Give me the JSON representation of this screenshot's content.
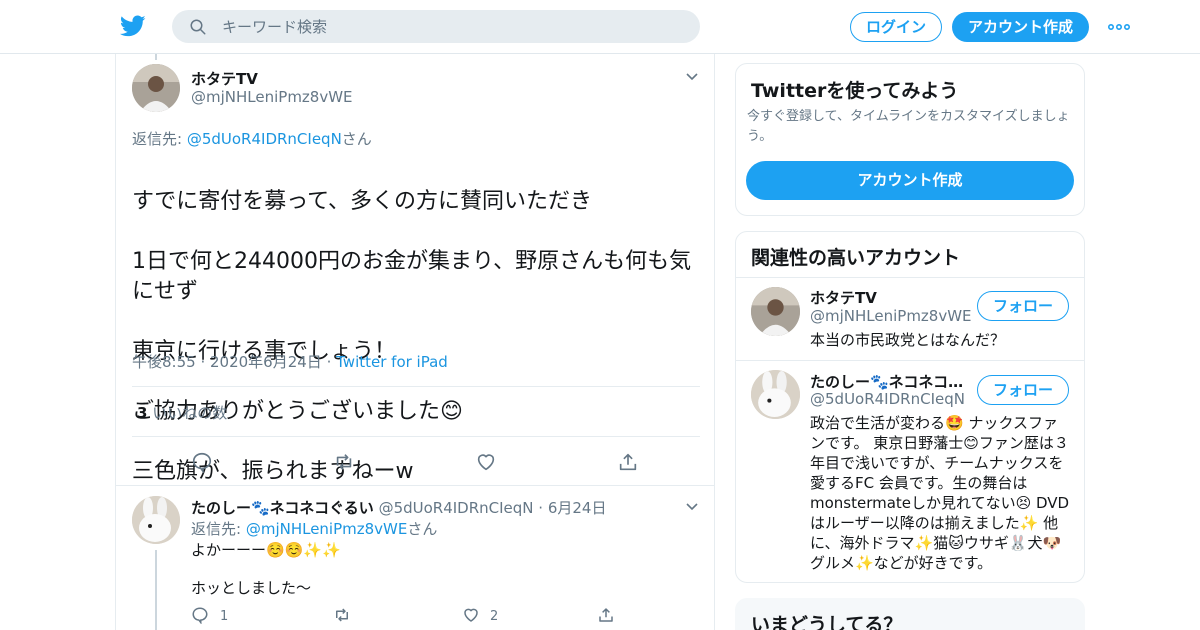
{
  "header": {
    "search_placeholder": "キーワード検索",
    "login_label": "ログイン",
    "signup_label": "アカウント作成",
    "accent_color": "#1da1f2"
  },
  "tweet": {
    "author_name": "ホタテTV",
    "author_handle": "@mjNHLeniPmz8vWE",
    "reply_to_prefix": "返信先: ",
    "reply_to_handle": "@5dUoR4IDRnCIeqN",
    "reply_to_suffix": "さん",
    "text_lines": [
      "すでに寄付を募って、多くの方に賛同いただき",
      "1日で何と244000円のお金が集まり、野原さんも何も気にせず",
      "東京に行ける事でしょう！",
      "ご協力ありがとうございました😊",
      "三色旗が、振られますねーw"
    ],
    "time": "午後8:55",
    "date": "2020年6月24日",
    "source": "Twitter for iPad",
    "likes_count": "3",
    "likes_label": "いいねの数"
  },
  "reply": {
    "author_name": "たのしー🐾ネコネコぐるい",
    "author_handle": "@5dUoR4IDRnCIeqN",
    "date": "6月24日",
    "reply_to_prefix": "返信先: ",
    "reply_to_handle": "@mjNHLeniPmz8vWE",
    "reply_to_suffix": "さん",
    "text": "よかーーー☺️☺️✨✨\n\nホッとしました〜",
    "reply_count": "1",
    "like_count": "2"
  },
  "sidebar": {
    "signup_card": {
      "title": "Twitterを使ってみよう",
      "description": "今すぐ登録して、タイムラインをカスタマイズしましょう。",
      "button": "アカウント作成"
    },
    "related": {
      "title": "関連性の高いアカウント",
      "follow_label": "フォロー",
      "accounts": [
        {
          "name": "ホタテTV",
          "handle": "@mjNHLeniPmz8vWE",
          "bio": "本当の市民政党とはなんだ？"
        },
        {
          "name": "たのしー🐾ネコネコぐるい",
          "handle": "@5dUoR4IDRnCIeqN",
          "bio": "政治で生活が変わる🤩 ナックスファンです。 東京日野藩士😊ファン歴は３年目で浅いですが、チームナックスを愛するFC 会員です。生の舞台はmonstermateしか見れてない😣 DVDはルーザー以降のは揃えました✨ 他に、海外ドラマ✨猫🐱ウサギ🐰犬🐶グルメ✨などが好きです。"
        }
      ]
    },
    "trending": {
      "title": "いまどうしてる？"
    }
  }
}
